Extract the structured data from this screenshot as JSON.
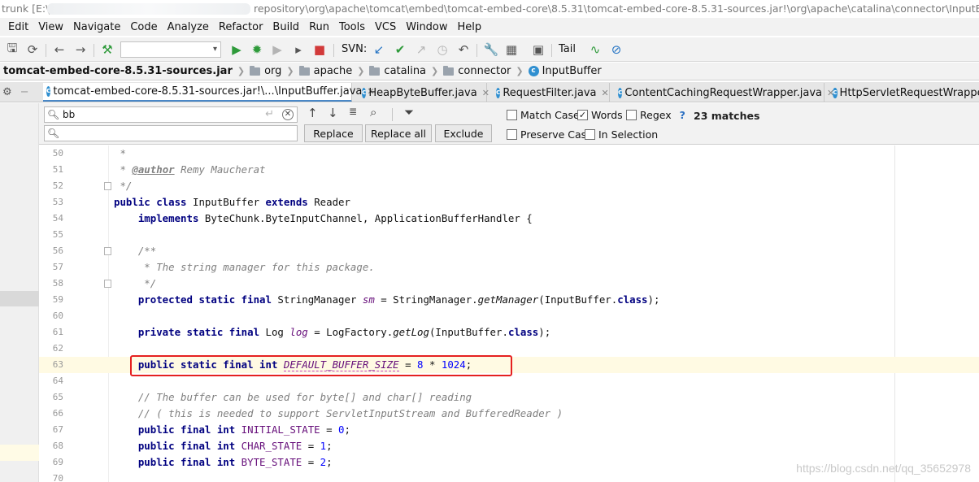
{
  "window": {
    "title_left": "trunk [E:\\j",
    "title_right": "repository\\org\\apache\\tomcat\\embed\\tomcat-embed-core\\8.5.31\\tomcat-embed-core-8.5.31-sources.jar!\\org\\apache\\catalina\\connector\\InputBuffer..."
  },
  "menu": [
    "Edit",
    "View",
    "Navigate",
    "Code",
    "Analyze",
    "Refactor",
    "Build",
    "Run",
    "Tools",
    "VCS",
    "Window",
    "Help"
  ],
  "toolbar": {
    "svn_label": "SVN:",
    "tail_label": "Tail",
    "icons": [
      "save-icon",
      "sync-icon",
      "back-icon",
      "forward-icon",
      "build-hammer-icon",
      "config-dropdown",
      "run-icon",
      "debug-icon",
      "run-coverage-icon",
      "profile-icon",
      "stop-icon",
      "svn-update-icon",
      "svn-commit-icon",
      "svn-compare-icon",
      "svn-history-icon",
      "svn-revert-icon",
      "settings-wrench-icon",
      "project-structure-icon",
      "terminal-icon",
      "tail-icon",
      "activity-monitor-icon",
      "no-entry-icon"
    ]
  },
  "breadcrumb": [
    "tomcat-embed-core-8.5.31-sources.jar",
    "org",
    "apache",
    "catalina",
    "connector",
    "InputBuffer"
  ],
  "tabs": [
    {
      "label": "tomcat-embed-core-8.5.31-sources.jar!\\...\\InputBuffer.java",
      "active": true
    },
    {
      "label": "HeapByteBuffer.java",
      "active": false
    },
    {
      "label": "RequestFilter.java",
      "active": false
    },
    {
      "label": "ContentCachingRequestWrapper.java",
      "active": false
    },
    {
      "label": "HttpServletRequestWrapper",
      "active": false
    }
  ],
  "find": {
    "search_value": "bb",
    "replace_value": "",
    "buttons": {
      "replace": "Replace",
      "replace_all": "Replace all",
      "exclude": "Exclude"
    },
    "options": {
      "match_case": {
        "label": "Match Case",
        "checked": false
      },
      "words": {
        "label": "Words",
        "checked": true
      },
      "regex": {
        "label": "Regex",
        "checked": false,
        "help": "?"
      },
      "preserve_case": {
        "label": "Preserve Case",
        "checked": false
      },
      "in_selection": {
        "label": "In Selection",
        "checked": false
      }
    },
    "matches": "23 matches"
  },
  "editor": {
    "line_numbers": [
      "50",
      "51",
      "52",
      "53",
      "54",
      "55",
      "56",
      "57",
      "58",
      "59",
      "60",
      "61",
      "62",
      "63",
      "64",
      "65",
      "66",
      "67",
      "68",
      "69",
      "70"
    ],
    "lines": {
      "l50": " *",
      "l51_tag": "@author",
      "l51_text": " Remy Maucherat",
      "l52": " */",
      "l53_kw1": "public class",
      "l53_mid": " InputBuffer ",
      "l53_kw2": "extends",
      "l53_end": " Reader",
      "l54_kw": "implements",
      "l54_text": " ByteChunk.ByteInputChannel, ApplicationBufferHandler {",
      "l56": "/**",
      "l57": " * The string manager for this package.",
      "l58": " */",
      "l59_kw": "protected static final",
      "l59_type": " StringManager ",
      "l59_field": "sm",
      "l59_eq": " = StringManager.",
      "l59_method": "getManager",
      "l59_arg": "(InputBuffer.",
      "l59_cls": "class",
      "l59_end": ");",
      "l61_kw": "private static final",
      "l61_type": " Log ",
      "l61_field": "log",
      "l61_eq": " = LogFactory.",
      "l61_method": "getLog",
      "l61_arg": "(InputBuffer.",
      "l61_cls": "class",
      "l61_end": ");",
      "l63_kw": "public static final int",
      "l63_field": "DEFAULT_BUFFER_SIZE",
      "l63_eq": " = ",
      "l63_n1": "8",
      "l63_op": " * ",
      "l63_n2": "1024",
      "l63_end": ";",
      "l65": "// The buffer can be used for byte[] and char[] reading",
      "l66": "// ( this is needed to support ServletInputStream and BufferedReader )",
      "l67_kw": "public final int",
      "l67_field": " INITIAL_STATE",
      "l67_eq": " = ",
      "l67_n": "0",
      "l67_end": ";",
      "l68_kw": "public final int",
      "l68_field": " CHAR_STATE",
      "l68_eq": " = ",
      "l68_n": "1",
      "l68_end": ";",
      "l69_kw": "public final int",
      "l69_field": " BYTE_STATE",
      "l69_eq": " = ",
      "l69_n": "2",
      "l69_end": ";"
    },
    "highlighted_line": "63"
  },
  "watermark": "https://blog.csdn.net/qq_35652978"
}
